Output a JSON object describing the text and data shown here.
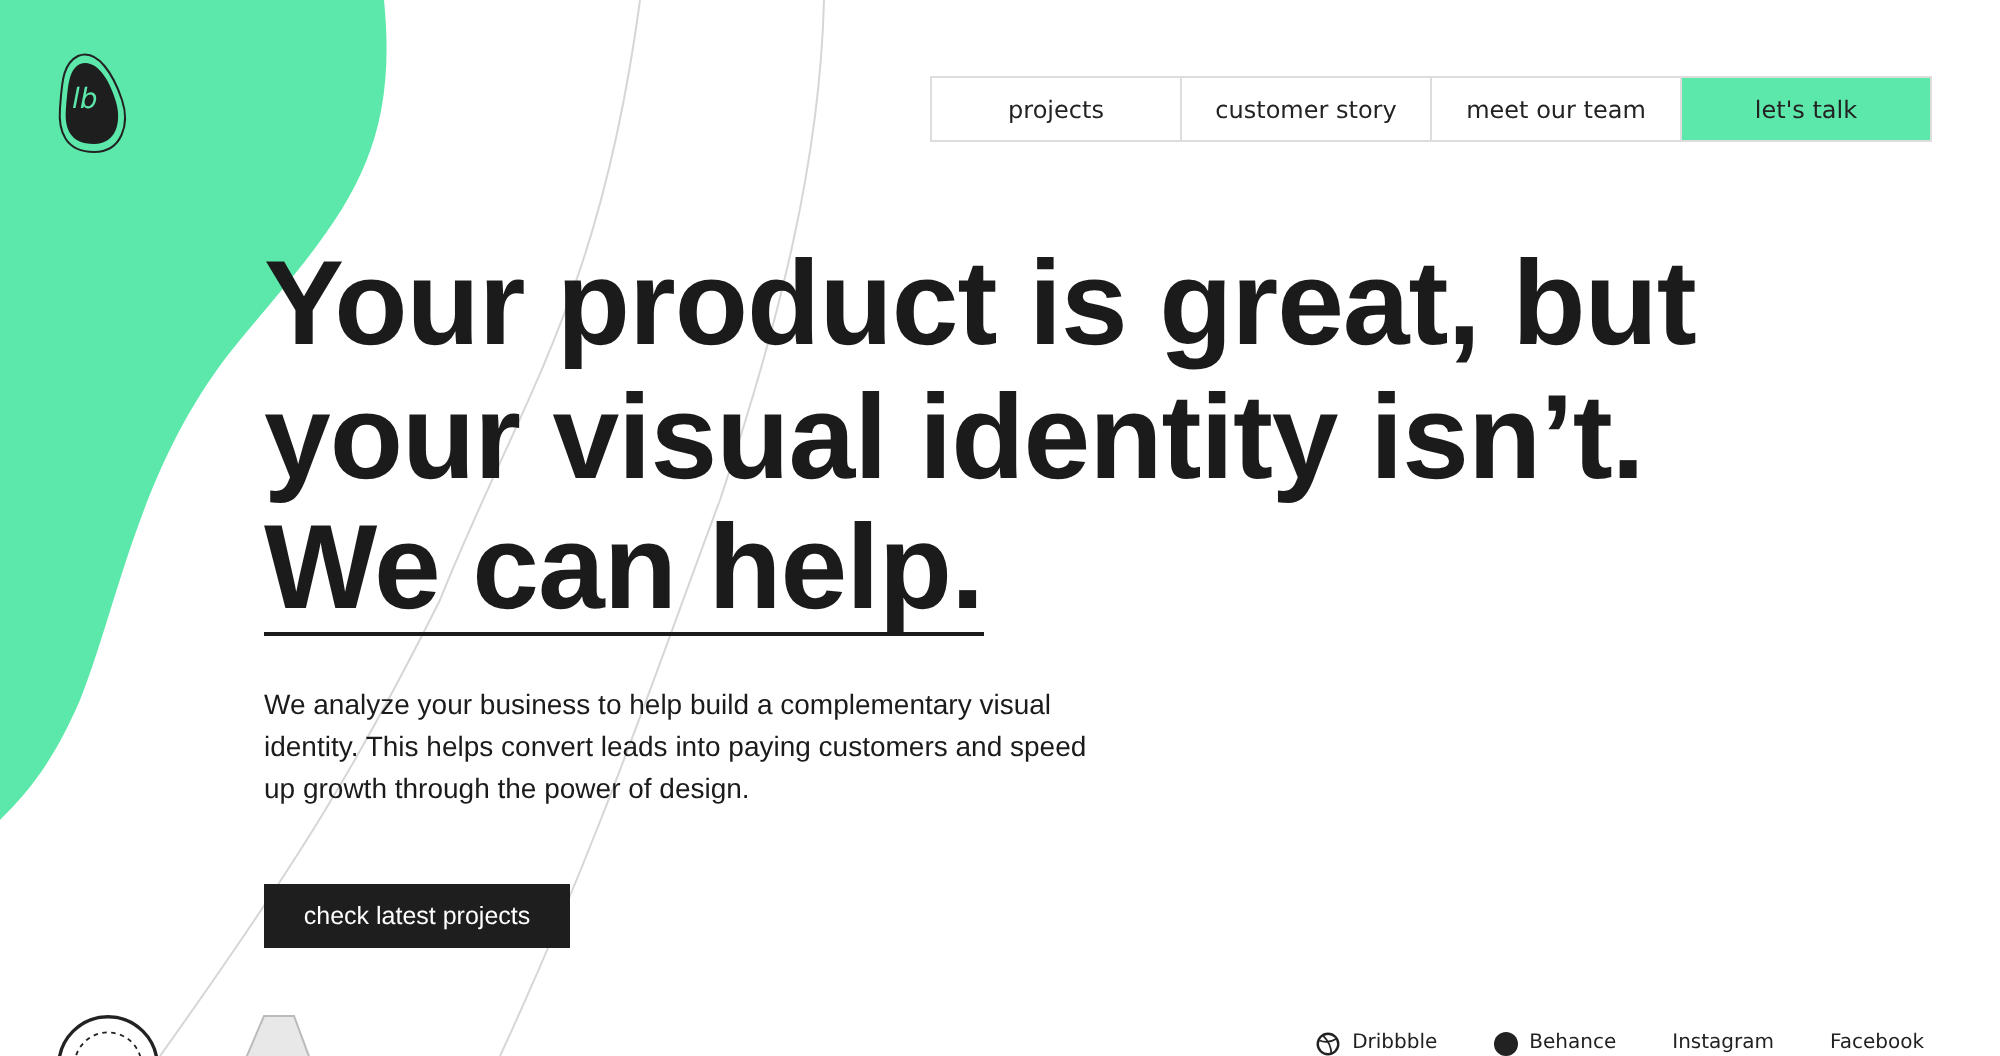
{
  "logo": {
    "text": "lb"
  },
  "nav": [
    {
      "label": "projects",
      "selected": false
    },
    {
      "label": "customer story",
      "selected": false
    },
    {
      "label": "meet our team",
      "selected": false
    },
    {
      "label": "let's talk",
      "selected": true
    }
  ],
  "hero": {
    "headline": [
      "Your product is great, but",
      "your visual identity isn’t."
    ],
    "emphasis": "We can help.",
    "body": "We analyze your business to help build a complementary visual identity. This helps convert leads into paying customers and speed up growth through the power of design.",
    "button": "check latest projects"
  },
  "social": [
    {
      "label": "Dribbble",
      "kind": "dribbble"
    },
    {
      "label": "Behance",
      "kind": "behance"
    },
    {
      "label": "Instagram",
      "kind": "plain"
    },
    {
      "label": "Facebook",
      "kind": "plain"
    }
  ]
}
